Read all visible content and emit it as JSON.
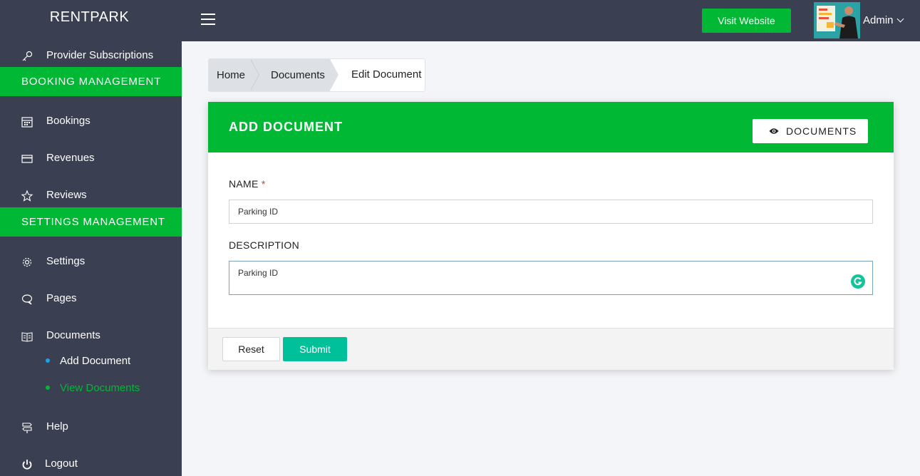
{
  "header": {
    "brand": "RENTPARK",
    "visit_button": "Visit Website",
    "user_name": "Admin"
  },
  "sidebar": {
    "items": [
      {
        "label": "Provider Subscriptions",
        "icon": "key-icon"
      },
      {
        "section": "BOOKING MANAGEMENT"
      },
      {
        "label": "Bookings",
        "icon": "calendar-icon"
      },
      {
        "label": "Revenues",
        "icon": "credit-card-icon"
      },
      {
        "label": "Reviews",
        "icon": "star-icon"
      },
      {
        "section": "SETTINGS MANAGEMENT"
      },
      {
        "label": "Settings",
        "icon": "gear-icon"
      },
      {
        "label": "Pages",
        "icon": "chat-bubble-icon"
      },
      {
        "label": "Documents",
        "icon": "book-icon"
      },
      {
        "label": "Add Document",
        "sub": true
      },
      {
        "label": "View Documents",
        "sub": true,
        "active": true
      },
      {
        "label": "Help",
        "icon": "signpost-icon"
      },
      {
        "label": "Logout",
        "icon": "power-icon"
      }
    ]
  },
  "breadcrumb": {
    "home": "Home",
    "documents": "Documents",
    "current": "Edit Document"
  },
  "card": {
    "title": "ADD DOCUMENT",
    "docs_button": "DOCUMENTS",
    "name_label": "NAME",
    "name_required": "*",
    "name_value": "Parking ID",
    "description_label": "DESCRIPTION",
    "description_value": "Parking ID",
    "reset_button": "Reset",
    "submit_button": "Submit"
  },
  "colors": {
    "sidebar_bg": "#3a3f51",
    "accent_green": "#00b833",
    "submit_teal": "#00c09a",
    "active_link": "#00b833",
    "dot_blue": "#1aa3e8"
  }
}
